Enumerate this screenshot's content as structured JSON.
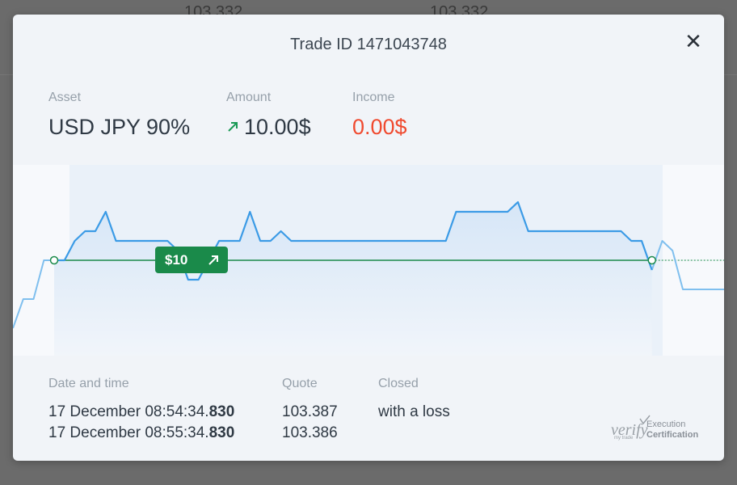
{
  "background": {
    "quotes": [
      "103.332",
      "103.332"
    ]
  },
  "modal": {
    "title": "Trade ID 1471043748",
    "close_symbol": "✕",
    "asset": {
      "label": "Asset",
      "value": "USD JPY 90%"
    },
    "amount": {
      "label": "Amount",
      "value": "10.00$",
      "direction_icon": "arrow-up-right-icon"
    },
    "income": {
      "label": "Income",
      "value": "0.00$",
      "color": "#f04a2f"
    },
    "trade_badge": {
      "label": "$10",
      "color": "#1a8a4a",
      "icon": "arrow-up-right-icon"
    },
    "details": {
      "date_label": "Date and time",
      "quote_label": "Quote",
      "closed_label": "Closed",
      "open_time_main": "17 December 08:54:34.",
      "open_time_ms": "830",
      "close_time_main": "17 December 08:55:34.",
      "close_time_ms": "830",
      "open_quote": "103.387",
      "close_quote": "103.386",
      "result": "with a loss"
    },
    "certification": {
      "brand": "verify",
      "sub": "my trade",
      "line1": "Execution",
      "line2": "Certification"
    }
  },
  "chart_data": {
    "type": "line",
    "entry_level": 103.387,
    "series": [
      {
        "values": [
          103.38,
          103.383,
          103.383,
          103.387,
          103.387,
          103.387,
          103.389,
          103.39,
          103.39,
          103.392,
          103.389,
          103.389,
          103.389,
          103.389,
          103.389,
          103.389,
          103.388,
          103.385,
          103.385,
          103.387,
          103.389,
          103.389,
          103.389,
          103.392,
          103.389,
          103.389,
          103.39,
          103.389,
          103.389,
          103.389,
          103.389,
          103.389,
          103.389,
          103.389,
          103.389,
          103.389,
          103.389,
          103.389,
          103.389,
          103.389,
          103.389,
          103.389,
          103.389,
          103.392,
          103.392,
          103.392,
          103.392,
          103.392,
          103.392,
          103.393,
          103.39,
          103.39,
          103.39,
          103.39,
          103.39,
          103.39,
          103.39,
          103.39,
          103.39,
          103.39,
          103.389,
          103.389,
          103.386,
          103.389,
          103.388,
          103.384,
          103.384,
          103.384,
          103.384,
          103.384
        ]
      }
    ],
    "active_start_index": 4,
    "active_end_index": 62,
    "ylim": [
      103.378,
      103.396
    ],
    "colors": {
      "line": "#3b9be6",
      "line_faded": "#7fbfee",
      "entry": "#1a8a4a",
      "fill": "#dfeaf7"
    }
  }
}
